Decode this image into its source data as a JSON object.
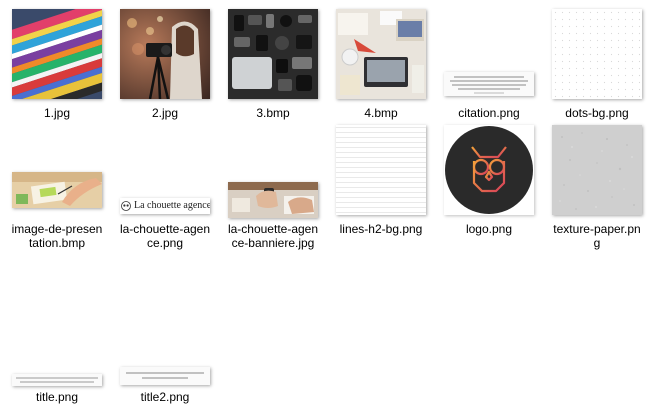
{
  "files": [
    {
      "id": "f1",
      "label": "1.jpg",
      "kind": "photo-magazines"
    },
    {
      "id": "f2",
      "label": "2.jpg",
      "kind": "photo-camera-woman"
    },
    {
      "id": "f3",
      "label": "3.bmp",
      "kind": "photo-flatlay-dark"
    },
    {
      "id": "f4",
      "label": "4.bmp",
      "kind": "photo-desk-laptop"
    },
    {
      "id": "f5",
      "label": "citation.png",
      "kind": "image-citation-text"
    },
    {
      "id": "f6",
      "label": "dots-bg.png",
      "kind": "image-dots-pattern"
    },
    {
      "id": "f7",
      "label": "image-de-presen\ntation.bmp",
      "kind": "photo-hand-writing"
    },
    {
      "id": "f8",
      "label": "la-chouette-agen\nce.png",
      "kind": "image-wordmark",
      "wordmark": "La chouette agence"
    },
    {
      "id": "f9",
      "label": "la-chouette-agen\nce-banniere.jpg",
      "kind": "photo-desk-banner"
    },
    {
      "id": "f10",
      "label": "lines-h2-bg.png",
      "kind": "image-lines-pattern"
    },
    {
      "id": "f11",
      "label": "logo.png",
      "kind": "image-owl-logo"
    },
    {
      "id": "f12",
      "label": "texture-paper.pn\ng",
      "kind": "image-paper-texture"
    },
    {
      "id": "f13",
      "label": "title.png",
      "kind": "image-title-text"
    },
    {
      "id": "f14",
      "label": "title2.png",
      "kind": "image-title2-text"
    }
  ],
  "colors": {
    "label": "#000000",
    "background": "#ffffff",
    "logo_accent": "#e07a3a"
  }
}
